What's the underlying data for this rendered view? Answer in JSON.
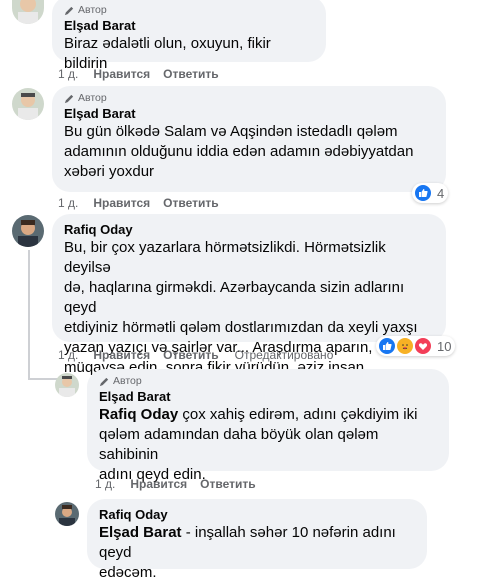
{
  "comments": [
    {
      "badge": "Автор",
      "name": "Elşad Barat",
      "text": "Biraz ədalətli olun, oxuyun, fikir bildirin",
      "time": "1 д.",
      "like": "Нравится",
      "reply": "Ответить"
    },
    {
      "badge": "Автор",
      "name": "Elşad Barat",
      "lines": [
        "Bu gün ölkədə Salam və Aqşindən istedadlı qələm",
        "adamının olduğunu iddia edən adamın ədəbiyyatdan",
        "xəbəri yoxdur"
      ],
      "time": "1 д.",
      "like": "Нравится",
      "reply": "Ответить",
      "reaction_count": "4"
    },
    {
      "name": "Rafiq Oday",
      "lines": [
        "Bu, bir çox yazarlara hörmətsizlikdi. Hörmətsizlik deyilsə",
        "də, haqlarına girməkdi. Azərbaycanda sizin adlarını qeyd",
        "etdiyiniz hörmətli qələm dostlarımızdan da xeyli yaxşı",
        "yazan yazıçı və şairlər var... Araşdırma aparın, oxuyun,",
        "müqaysə edin, sonra fikir yürüdün, əziz insan..."
      ],
      "time": "1 д.",
      "like": "Нравится",
      "reply": "Ответить",
      "edited": "Отредактировано",
      "reaction_count": "10"
    },
    {
      "badge": "Автор",
      "name": "Elşad Barat",
      "mention": "Rafiq Oday",
      "lines": [
        " çox xahiş edirəm, adını çəkdiyim iki",
        "qələm adamından daha böyük olan qələm sahibinin",
        "adını qeyd edin."
      ],
      "time": "1 д.",
      "like": "Нравится",
      "reply": "Ответить"
    },
    {
      "name": "Rafiq Oday",
      "mention": "Elşad Barat",
      "lines": [
        " - inşallah səhər 10 nəfərin adını qeyd",
        "edəcəm."
      ]
    }
  ],
  "colors": {
    "bubble": "#f0f2f5",
    "meta": "#65676b",
    "like_blue": "#1877f2",
    "heart_red": "#f33e58",
    "care_yellow": "#f7b125"
  },
  "icons": [
    "pen-icon",
    "like-reaction-icon",
    "care-reaction-icon",
    "love-reaction-icon"
  ]
}
